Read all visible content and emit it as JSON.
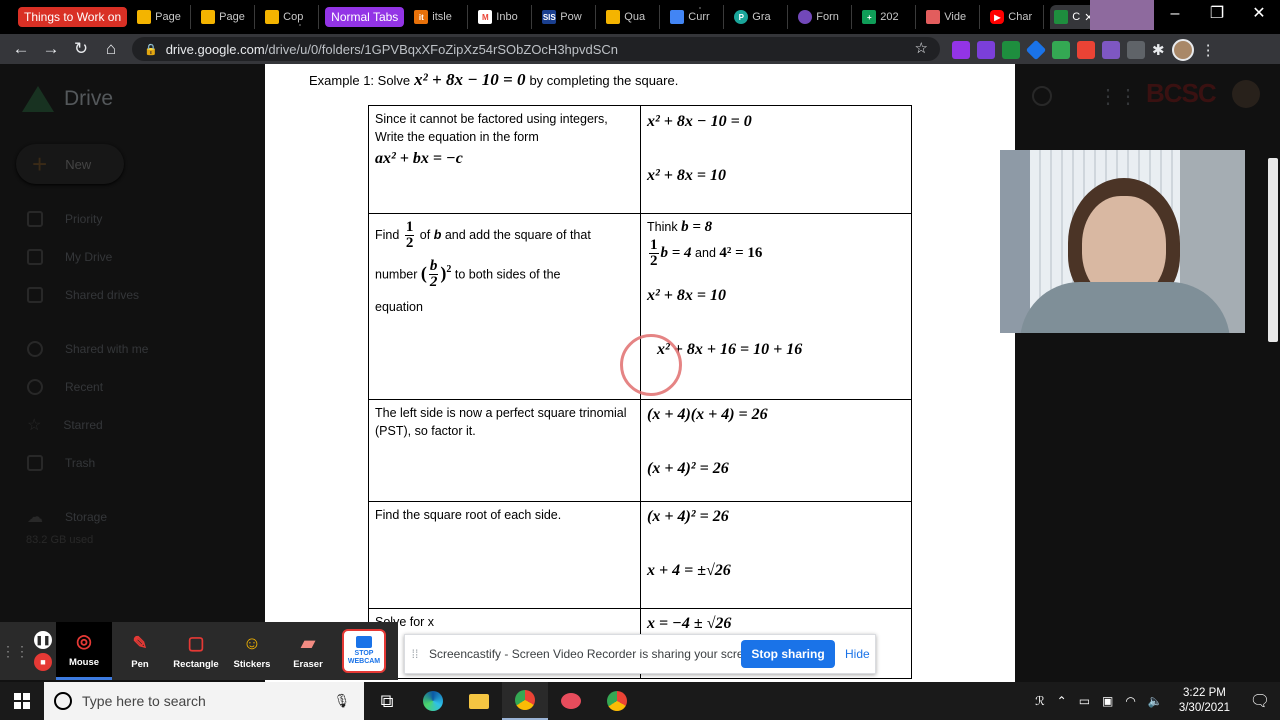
{
  "browser": {
    "tab_groups": {
      "things": "Things to Work on",
      "normal": "Normal Tabs"
    },
    "tabs": [
      {
        "label": "Page",
        "icon": "slides-icon",
        "color": "#f4b400"
      },
      {
        "label": "Page",
        "icon": "slides-icon",
        "color": "#f4b400"
      },
      {
        "label": "Cop",
        "icon": "slides-icon",
        "color": "#f4b400"
      },
      {
        "label": "itsle",
        "icon": "itslearning-icon",
        "color": "#e8710a"
      },
      {
        "label": "Inbo",
        "icon": "gmail-icon",
        "color": "#ea4335"
      },
      {
        "label": "Pow",
        "icon": "sis-icon",
        "color": "#1a3f8f"
      },
      {
        "label": "Qua",
        "icon": "slides-icon",
        "color": "#f4b400"
      },
      {
        "label": "Curr",
        "icon": "docs-icon",
        "color": "#4285f4"
      },
      {
        "label": "Gra",
        "icon": "grammar-icon",
        "color": "#1aa59a"
      },
      {
        "label": "Forn",
        "icon": "forms-icon",
        "color": "#7248b9"
      },
      {
        "label": "202",
        "icon": "sheets-icon",
        "color": "#0f9d58"
      },
      {
        "label": "Vide",
        "icon": "video-icon",
        "color": "#e25d5d"
      },
      {
        "label": "Char",
        "icon": "youtube-icon",
        "color": "#ff0000"
      }
    ],
    "active_tab_label": "C",
    "url_host": "drive.google.com",
    "url_path": "/drive/u/0/folders/1GPVBqxXFoZipXz54rSObZOcH3hpvdSCn"
  },
  "drive": {
    "logo_text": "Drive",
    "new_label": "New",
    "nav": [
      "Priority",
      "My Drive",
      "Shared drives",
      "Shared with me",
      "Recent",
      "Starred",
      "Trash",
      "Storage"
    ],
    "storage_used": "83.2 GB used",
    "brand": "BCSC"
  },
  "document": {
    "example_prefix": "Example 1:  Solve",
    "example_equation": "x² + 8x − 10 = 0",
    "example_suffix": "by completing the square.",
    "rows": [
      {
        "left_text": "Since it cannot be factored using integers, Write the equation in the form",
        "left_math": "ax² + bx = −c",
        "right": [
          "x² + 8x − 10 = 0",
          "x² + 8x = 10"
        ]
      },
      {
        "left_find": "Find",
        "left_of": "of",
        "left_b": "b",
        "left_rest": "and add the square of that",
        "left_number": "number",
        "left_sides": "to both sides of the",
        "left_eq": "equation",
        "right_think": "Think",
        "right_think_math": "b = 8",
        "right_half": "b = 4",
        "right_and": "and",
        "right_sq": "4² = 16",
        "right": [
          "x² + 8x = 10",
          "x² + 8x + 16 = 10 + 16"
        ]
      },
      {
        "left_text": "The left side is now a perfect square trinomial (PST), so factor it.",
        "right": [
          "(x + 4)(x + 4) = 26",
          "(x + 4)² = 26"
        ]
      },
      {
        "left_text": "Find the square root of each side.",
        "right": [
          "(x + 4)² = 26",
          "x + 4 = ±√26"
        ]
      },
      {
        "left_text": "Solve for x",
        "right": [
          "x = −4 ± √26"
        ]
      }
    ]
  },
  "screencastify": {
    "tools": [
      {
        "label": "Mouse",
        "icon": "mouse-icon"
      },
      {
        "label": "Pen",
        "icon": "pen-icon"
      },
      {
        "label": "Rectangle",
        "icon": "rectangle-icon"
      },
      {
        "label": "Stickers",
        "icon": "sticker-icon"
      },
      {
        "label": "Eraser",
        "icon": "eraser-icon"
      }
    ],
    "stop_webcam": "STOP WEBCAM",
    "share_message": "Screencastify - Screen Video Recorder is sharing your screen.",
    "stop_sharing": "Stop sharing",
    "hide": "Hide"
  },
  "taskbar": {
    "search_placeholder": "Type here to search",
    "time": "3:22 PM",
    "date": "3/30/2021"
  },
  "colors": {
    "accent_blue": "#1a73e8",
    "record_red": "#e53935",
    "tab_group_red": "#d93025",
    "tab_group_purple": "#9334e6"
  }
}
